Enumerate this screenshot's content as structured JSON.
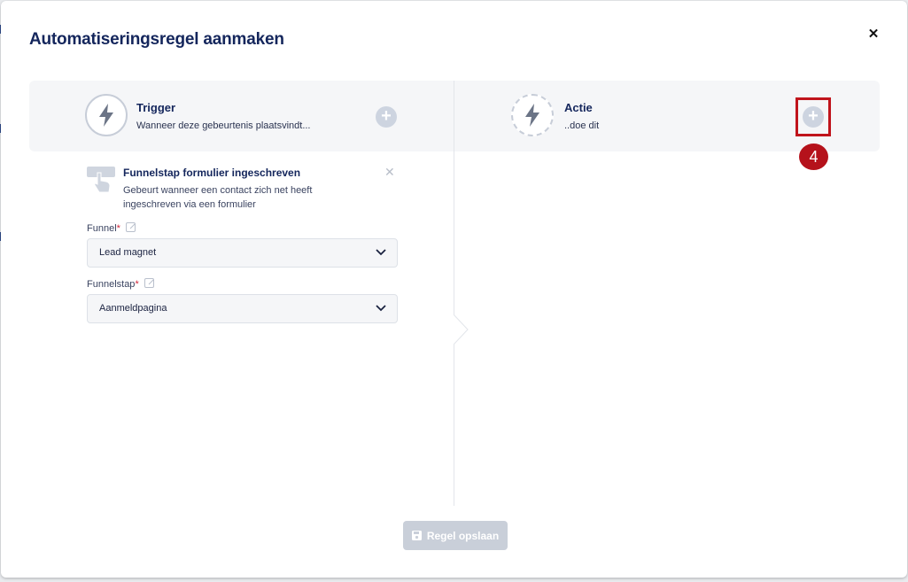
{
  "dialog": {
    "title": "Automatiseringsregel aanmaken",
    "close_icon": "close-icon"
  },
  "trigger": {
    "title": "Trigger",
    "subtitle": "Wanneer deze gebeurtenis plaatsvindt...",
    "icon": "lightning-icon",
    "add_icon": "plus-icon"
  },
  "action": {
    "title": "Actie",
    "subtitle": "..doe dit",
    "icon": "lightning-cycle-icon",
    "add_icon": "plus-icon",
    "annotation_number": "4"
  },
  "trigger_card": {
    "title": "Funnelstap formulier ingeschreven",
    "description": "Gebeurt wanneer een contact zich net heeft ingeschreven via een formulier",
    "icon": "hand-pointer-form-icon",
    "remove_icon": "close-icon"
  },
  "fields": [
    {
      "label": "Funnel",
      "required_mark": "*",
      "value": "Lead magnet"
    },
    {
      "label": "Funnelstap",
      "required_mark": "*",
      "value": "Aanmeldpagina"
    }
  ],
  "footer": {
    "save_label": "Regel opslaan",
    "save_icon": "save-icon"
  },
  "colors": {
    "primary_text": "#14265c",
    "annotation_red": "#b5121b",
    "disabled_button": "#c9cfd9"
  }
}
